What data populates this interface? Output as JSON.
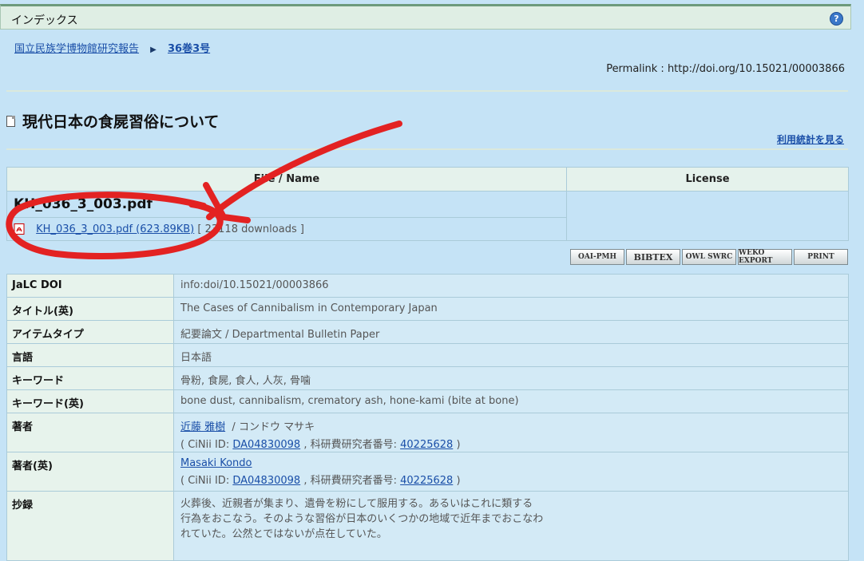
{
  "header": {
    "title": "インデックス",
    "help_glyph": "?"
  },
  "breadcrumb": {
    "item1": "国立民族学博物館研究報告",
    "item2": "36巻3号"
  },
  "permalink": "Permalink : http://doi.org/10.15021/00003866",
  "page_title": "現代日本の食屍習俗について",
  "stats_link": "利用統計を見る",
  "files_table": {
    "col_file": "File / Name",
    "col_license": "License",
    "file_name": "KH_036_3_003.pdf",
    "file_link": "KH_036_3_003.pdf (623.89KB)",
    "downloads": "[ 23118 downloads ]"
  },
  "export_buttons": [
    "OAI-PMH",
    "BIBTEX",
    "OWL SWRC",
    "WEKO EXPORT",
    "PRINT"
  ],
  "metadata": {
    "jalc_doi": {
      "label": "JaLC DOI",
      "value": "info:doi/10.15021/00003866"
    },
    "title_en": {
      "label": "タイトル(英)",
      "value": "The Cases of Cannibalism in Contemporary Japan"
    },
    "item_type": {
      "label": "アイテムタイプ",
      "value": "紀要論文 / Departmental Bulletin Paper"
    },
    "language": {
      "label": "言語",
      "value": "日本語"
    },
    "keywords": {
      "label": "キーワード",
      "value": "骨粉, 食屍, 食人, 人灰, 骨噛"
    },
    "keywords_en": {
      "label": "キーワード(英)",
      "value": "bone dust, cannibalism, crematory ash, hone-kami (bite at bone)"
    },
    "author": {
      "label": "著者",
      "name": "近藤 雅樹",
      "sep": "/",
      "kana": "コンドウ マサキ",
      "cinii_prefix": "( CiNii ID:",
      "cinii_id": "DA04830098",
      "kaken_prefix": ", 科研費研究者番号:",
      "kaken_id": "40225628",
      "close": ")"
    },
    "author_en": {
      "label": "著者(英)",
      "name": "Masaki Kondo",
      "cinii_prefix": "( CiNii ID:",
      "cinii_id": "DA04830098",
      "kaken_prefix": ", 科研費研究者番号:",
      "kaken_id": "40225628",
      "close": ")"
    },
    "abstract": {
      "label": "抄録",
      "line1": "火葬後、近親者が集まり、遺骨を粉にして服用する。あるいはこれに類する",
      "line2": "行為をおこなう。そのような習俗が日本のいくつかの地域で近年までおこなわ",
      "line3": "れていた。公然とではないが点在していた。"
    }
  },
  "annotation_color": "#e32222"
}
